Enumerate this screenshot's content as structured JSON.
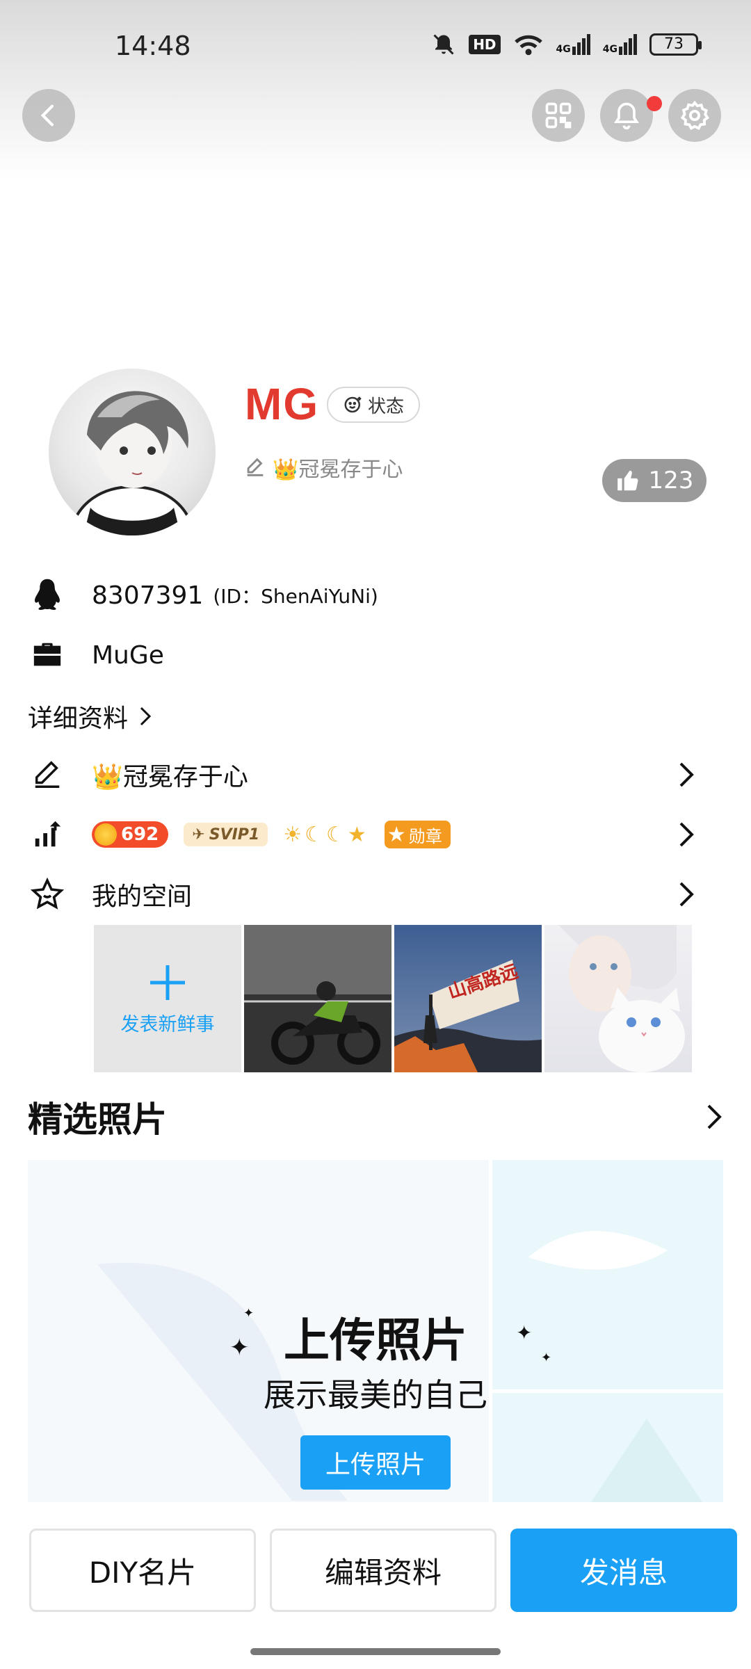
{
  "status_bar": {
    "time": "14:48",
    "hd": "HD",
    "net1": "4G",
    "net2": "4G",
    "battery": "73"
  },
  "profile": {
    "name": "MG",
    "status_label": "状态",
    "signature": "👑冠冕存于心",
    "likes": "123",
    "qq_number": "8307391",
    "id_text": "(ID：ShenAiYuNi)",
    "company": "MuGe"
  },
  "details_link": "详细资料",
  "signature_row": "👑冠冕存于心",
  "level": {
    "coin_count": "692",
    "svip": "SVIP1",
    "medal": "勋章"
  },
  "my_space": {
    "label": "我的空间",
    "post_label": "发表新鲜事"
  },
  "featured_photos": {
    "title": "精选照片",
    "heading": "上传照片",
    "subheading": "展示最美的自己",
    "upload_button": "上传照片"
  },
  "bottom_buttons": {
    "diy": "DIY名片",
    "edit": "编辑资料",
    "message": "发消息"
  },
  "colors": {
    "accent": "#1aa1f5",
    "name_red": "#e23a2f"
  }
}
